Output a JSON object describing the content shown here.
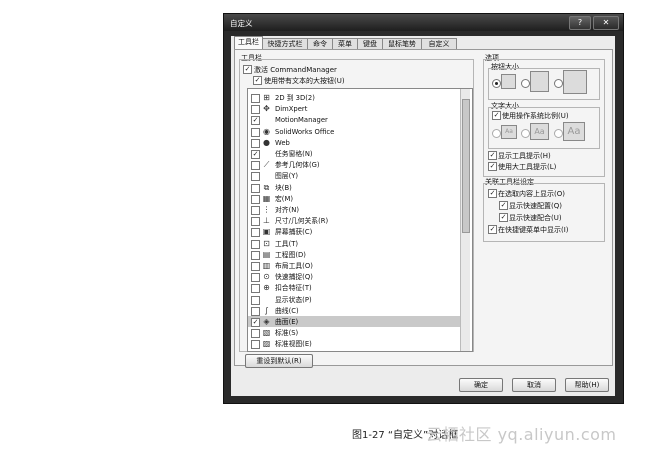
{
  "window": {
    "title": "自定义",
    "help_glyph": "?",
    "close_glyph": "✕"
  },
  "tabs": [
    {
      "label": "工具栏"
    },
    {
      "label": "快捷方式栏"
    },
    {
      "label": "命令"
    },
    {
      "label": "菜单"
    },
    {
      "label": "键盘"
    },
    {
      "label": "鼠标笔势"
    },
    {
      "label": "自定义"
    }
  ],
  "toolbar_section": {
    "heading": "工具栏",
    "activate_cm": {
      "label": "激活 CommandManager",
      "checked": true
    },
    "large_buttons": {
      "label": "使用带有文本的大按钮(U)",
      "checked": true
    },
    "items": [
      {
        "label": "2D 到 3D(2)",
        "checked": false,
        "icon": "2d-to-3d-icon",
        "glyph": "⊞"
      },
      {
        "label": "DimXpert",
        "checked": false,
        "icon": "dimxpert-icon",
        "glyph": "✥"
      },
      {
        "label": "MotionManager",
        "checked": true,
        "icon": "",
        "glyph": ""
      },
      {
        "label": "SolidWorks Office",
        "checked": false,
        "icon": "solidworks-office-icon",
        "glyph": "◉"
      },
      {
        "label": "Web",
        "checked": false,
        "icon": "web-globe-icon",
        "glyph": "●"
      },
      {
        "label": "任务窗格(N)",
        "checked": true,
        "icon": "",
        "glyph": ""
      },
      {
        "label": "参考几何体(G)",
        "checked": false,
        "icon": "reference-geometry-icon",
        "glyph": "⟋"
      },
      {
        "label": "图层(Y)",
        "checked": false,
        "icon": "",
        "glyph": ""
      },
      {
        "label": "块(B)",
        "checked": false,
        "icon": "block-icon",
        "glyph": "⧉"
      },
      {
        "label": "宏(M)",
        "checked": false,
        "icon": "macro-icon",
        "glyph": "▦"
      },
      {
        "label": "对齐(N)",
        "checked": false,
        "icon": "align-icon",
        "glyph": "⋮"
      },
      {
        "label": "尺寸/几何关系(R)",
        "checked": false,
        "icon": "dimension-icon",
        "glyph": "⊥"
      },
      {
        "label": "屏幕捕获(C)",
        "checked": false,
        "icon": "screen-capture-icon",
        "glyph": "▣"
      },
      {
        "label": "工具(T)",
        "checked": false,
        "icon": "tools-icon",
        "glyph": "⊡"
      },
      {
        "label": "工程图(D)",
        "checked": false,
        "icon": "drawing-icon",
        "glyph": "▤"
      },
      {
        "label": "布局工具(O)",
        "checked": false,
        "icon": "layout-tools-icon",
        "glyph": "▥"
      },
      {
        "label": "快速捕捉(Q)",
        "checked": false,
        "icon": "quick-snap-icon",
        "glyph": "⊙"
      },
      {
        "label": "扣合特征(T)",
        "checked": false,
        "icon": "fastening-feature-icon",
        "glyph": "⊕"
      },
      {
        "label": "显示状态(P)",
        "checked": false,
        "icon": "",
        "glyph": ""
      },
      {
        "label": "曲线(C)",
        "checked": false,
        "icon": "curves-icon",
        "glyph": "∫"
      },
      {
        "label": "曲面(E)",
        "checked": true,
        "icon": "surfaces-icon",
        "glyph": "◈",
        "selected": true
      },
      {
        "label": "标准(S)",
        "checked": false,
        "icon": "standard-icon",
        "glyph": "▧"
      },
      {
        "label": "标准视图(E)",
        "checked": false,
        "icon": "standard-views-icon",
        "glyph": "▨"
      }
    ],
    "reset_button": "重设到默认(R)"
  },
  "options_section": {
    "heading": "选项",
    "button_size": {
      "heading": "按钮大小",
      "selected_index": 0
    },
    "text_size": {
      "heading": "文字大小",
      "use_system_scale": {
        "label": "使用操作系统比例(U)",
        "checked": true
      },
      "samples": [
        "Aa",
        "Aa",
        "Aa"
      ]
    },
    "show_tooltips": {
      "label": "显示工具提示(H)",
      "checked": true
    },
    "large_tooltips": {
      "label": "使用大工具提示(L)",
      "checked": true
    }
  },
  "context_section": {
    "heading": "关联工具栏设定",
    "show_on_selection": {
      "label": "在选取内容上显示(O)",
      "checked": true
    },
    "show_quick_config": {
      "label": "显示快速配置(Q)",
      "checked": true
    },
    "show_quick_mate": {
      "label": "显示快速配合(U)",
      "checked": true
    },
    "show_in_shortcut_menu": {
      "label": "在快捷键菜单中显示(I)",
      "checked": true
    }
  },
  "footer": {
    "ok": "确定",
    "cancel": "取消",
    "help": "帮助(H)"
  },
  "caption": "图1-27 “自定义”对话框",
  "watermark": "云栖社区 yq.aliyun.com",
  "colors": {
    "title_bar": "#2a2a2a",
    "dialog_face": "#ececec",
    "selected_row": "#c9c9c9"
  }
}
